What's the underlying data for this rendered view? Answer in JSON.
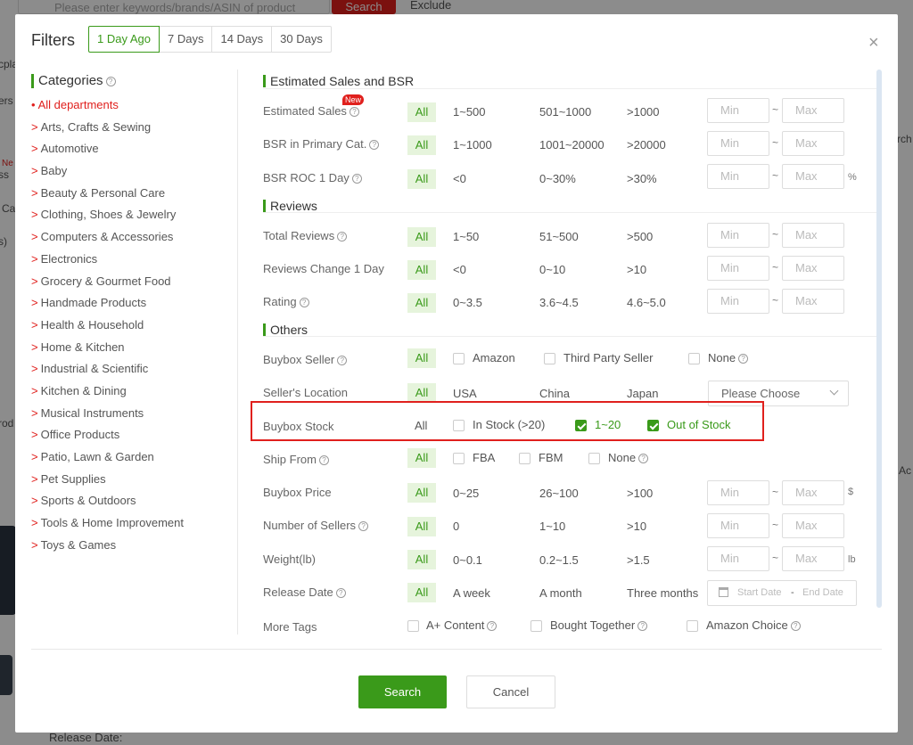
{
  "background": {
    "search_placeholder": "Please enter keywords/brands/ASIN of product",
    "search_button": "Search",
    "exclude_label": "Exclude",
    "release_date_label": "Release Date:",
    "fragments": [
      "cpla",
      "ers",
      "Ne",
      "ss",
      "Ca",
      "s)",
      "rod",
      "Ac",
      "rch"
    ]
  },
  "modal": {
    "title": "Filters",
    "close_glyph": "×",
    "time_tabs": [
      "1 Day Ago",
      "7 Days",
      "14 Days",
      "30 Days"
    ],
    "active_tab": "1 Day Ago"
  },
  "categories": {
    "heading": "Categories",
    "items": [
      {
        "label": "All departments",
        "prefix": "•",
        "selected": true
      },
      {
        "label": "Arts, Crafts & Sewing",
        "prefix": ">"
      },
      {
        "label": "Automotive",
        "prefix": ">"
      },
      {
        "label": "Baby",
        "prefix": ">"
      },
      {
        "label": "Beauty & Personal Care",
        "prefix": ">"
      },
      {
        "label": "Clothing, Shoes & Jewelry",
        "prefix": ">"
      },
      {
        "label": "Computers & Accessories",
        "prefix": ">"
      },
      {
        "label": "Electronics",
        "prefix": ">"
      },
      {
        "label": "Grocery & Gourmet Food",
        "prefix": ">"
      },
      {
        "label": "Handmade Products",
        "prefix": ">"
      },
      {
        "label": "Health & Household",
        "prefix": ">"
      },
      {
        "label": "Home & Kitchen",
        "prefix": ">"
      },
      {
        "label": "Industrial & Scientific",
        "prefix": ">"
      },
      {
        "label": "Kitchen & Dining",
        "prefix": ">"
      },
      {
        "label": "Musical Instruments",
        "prefix": ">"
      },
      {
        "label": "Office Products",
        "prefix": ">"
      },
      {
        "label": "Patio, Lawn & Garden",
        "prefix": ">"
      },
      {
        "label": "Pet Supplies",
        "prefix": ">"
      },
      {
        "label": "Sports & Outdoors",
        "prefix": ">"
      },
      {
        "label": "Tools & Home Improvement",
        "prefix": ">"
      },
      {
        "label": "Toys & Games",
        "prefix": ">"
      }
    ]
  },
  "sections": {
    "sales_bsr": "Estimated Sales and BSR",
    "reviews": "Reviews",
    "others": "Others"
  },
  "rows": {
    "estimated_sales": {
      "label": "Estimated Sales",
      "badge": "New",
      "all": "All",
      "opts": [
        "1~500",
        "501~1000",
        ">1000"
      ],
      "min": "Min",
      "max": "Max",
      "tilde": "~"
    },
    "bsr_primary": {
      "label": "BSR in Primary Cat.",
      "all": "All",
      "opts": [
        "1~1000",
        "1001~20000",
        ">20000"
      ],
      "min": "Min",
      "max": "Max",
      "tilde": "~"
    },
    "bsr_roc": {
      "label": "BSR ROC 1 Day",
      "all": "All",
      "opts": [
        "<0",
        "0~30%",
        ">30%"
      ],
      "min": "Min",
      "max": "Max",
      "tilde": "~",
      "unit": "%"
    },
    "total_reviews": {
      "label": "Total Reviews",
      "all": "All",
      "opts": [
        "1~50",
        "51~500",
        ">500"
      ],
      "min": "Min",
      "max": "Max",
      "tilde": "~"
    },
    "reviews_change": {
      "label": "Reviews Change 1 Day",
      "all": "All",
      "opts": [
        "<0",
        "0~10",
        ">10"
      ],
      "min": "Min",
      "max": "Max",
      "tilde": "~"
    },
    "rating": {
      "label": "Rating",
      "all": "All",
      "opts": [
        "0~3.5",
        "3.6~4.5",
        "4.6~5.0"
      ],
      "min": "Min",
      "max": "Max",
      "tilde": "~"
    },
    "buybox_seller": {
      "label": "Buybox Seller",
      "all": "All",
      "opts": [
        "Amazon",
        "Third Party Seller",
        "None"
      ]
    },
    "seller_location": {
      "label": "Seller's Location",
      "all": "All",
      "opts": [
        "USA",
        "China",
        "Japan"
      ],
      "select_placeholder": "Please Choose"
    },
    "buybox_stock": {
      "label": "Buybox Stock",
      "all": "All",
      "opts": [
        {
          "label": "In Stock (>20)",
          "checked": false
        },
        {
          "label": "1~20",
          "checked": true
        },
        {
          "label": "Out of Stock",
          "checked": true
        }
      ]
    },
    "ship_from": {
      "label": "Ship From",
      "all": "All",
      "opts": [
        "FBA",
        "FBM",
        "None"
      ]
    },
    "buybox_price": {
      "label": "Buybox Price",
      "all": "All",
      "opts": [
        "0~25",
        "26~100",
        ">100"
      ],
      "min": "Min",
      "max": "Max",
      "tilde": "~",
      "unit": "$"
    },
    "num_sellers": {
      "label": "Number of Sellers",
      "all": "All",
      "opts": [
        "0",
        "1~10",
        ">10"
      ],
      "min": "Min",
      "max": "Max",
      "tilde": "~"
    },
    "weight": {
      "label": "Weight(lb)",
      "all": "All",
      "opts": [
        "0~0.1",
        "0.2~1.5",
        ">1.5"
      ],
      "min": "Min",
      "max": "Max",
      "tilde": "~",
      "unit": "lb"
    },
    "release_date": {
      "label": "Release Date",
      "all": "All",
      "opts": [
        "A week",
        "A month",
        "Three months"
      ],
      "start_placeholder": "Start Date",
      "end_placeholder": "End Date",
      "sep": "-"
    },
    "more_tags": {
      "label": "More Tags",
      "opts": [
        "A+ Content",
        "Bought Together",
        "Amazon Choice"
      ]
    }
  },
  "footer": {
    "search_label": "Search",
    "cancel_label": "Cancel"
  },
  "colors": {
    "accent_green": "#3a9a1a",
    "all_bg": "#e6f4dc",
    "highlight_red": "#e0201d"
  }
}
